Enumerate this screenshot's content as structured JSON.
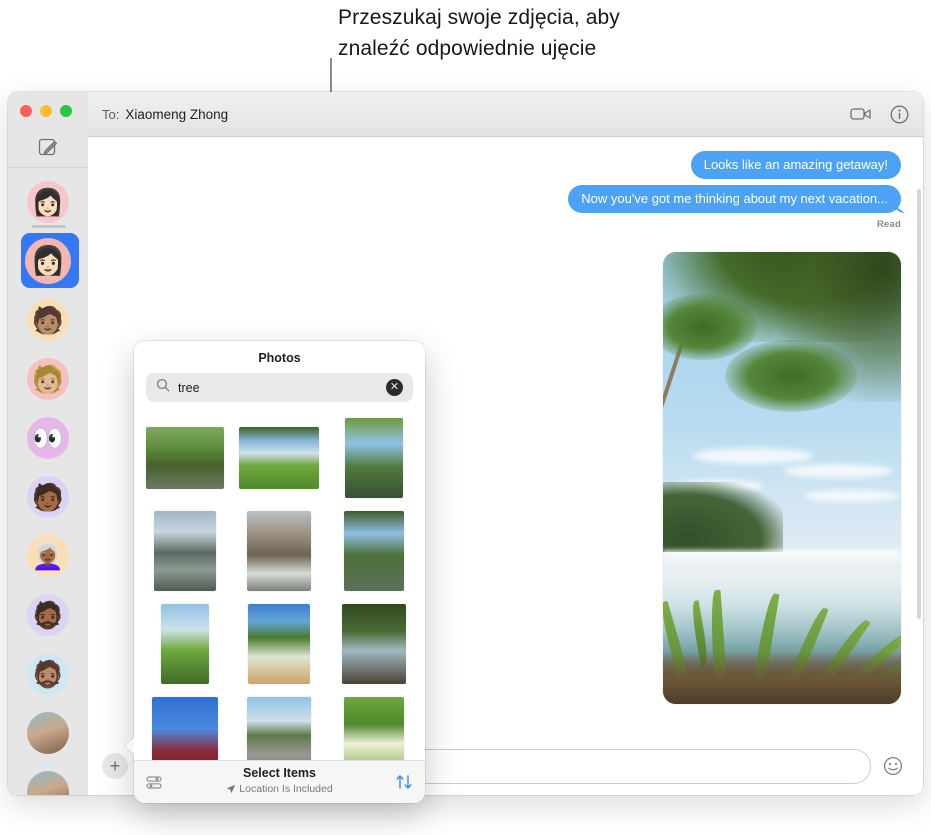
{
  "callout": {
    "line1": "Przeszukaj swoje zdjęcia, aby",
    "line2": "znaleźć odpowiednie ujęcie"
  },
  "colors": {
    "bubble_blue": "#4da2f5",
    "selection_blue": "#3478f6",
    "accent_blue": "#3d87f0",
    "sidebar_gray": "#e6e6e6",
    "titlebar_gray": "#e9e9e9"
  },
  "window": {
    "traffic_lights": [
      "close",
      "minimize",
      "zoom"
    ],
    "compose_icon": "compose-icon",
    "titlebar": {
      "to_label": "To:",
      "recipient": "Xiaomeng Zhong",
      "facetime_icon": "video-camera-icon",
      "info_icon": "info-circle-icon"
    }
  },
  "sidebar": {
    "conversations": [
      {
        "avatar": "memoji-woman-glasses",
        "emoji": "👩🏻",
        "bg": "#f7c6cc",
        "selected": false
      },
      {
        "avatar": "memoji-woman-bob",
        "emoji": "👩🏻",
        "bg": "#f3b7b0",
        "selected": true
      },
      {
        "avatar": "memoji-person-green-cap",
        "emoji": "🧑🏽",
        "bg": "#f7e0b5",
        "selected": false
      },
      {
        "avatar": "memoji-person-glasses",
        "emoji": "🧑🏼",
        "bg": "#f5c0c0",
        "selected": false
      },
      {
        "avatar": "memoji-eyes",
        "emoji": "👀",
        "bg": "#e7b6ea",
        "selected": false
      },
      {
        "avatar": "memoji-person-sunglasses",
        "emoji": "🧑🏾",
        "bg": "#ddd2f3",
        "selected": false
      },
      {
        "avatar": "memoji-woman-gray-hair",
        "emoji": "👩🏾‍🦳",
        "bg": "#fbdfb4",
        "selected": false
      },
      {
        "avatar": "memoji-man-beanie",
        "emoji": "🧔🏾",
        "bg": "#dcd4f5",
        "selected": false
      },
      {
        "avatar": "memoji-man-beard",
        "emoji": "🧔🏽",
        "bg": "#cfe7f5",
        "selected": false
      },
      {
        "avatar": "photo-avatar-woman",
        "emoji": "",
        "bg": "#cbbfae",
        "selected": false
      },
      {
        "avatar": "photo-avatar-person",
        "emoji": "",
        "bg": "#e8a65a",
        "selected": false
      }
    ]
  },
  "conversation": {
    "messages": [
      {
        "text": "Looks like an amazing getaway!",
        "side": "outgoing",
        "tail": false
      },
      {
        "text": "Now you've got me thinking about my next vacation...",
        "side": "outgoing",
        "tail": true
      }
    ],
    "read_receipt": "Read",
    "attachment": {
      "name": "tropical-beach-palm-trees-photo",
      "description": "Palm trees over a tropical beach with green foliage"
    }
  },
  "composer": {
    "add_button_label": "+",
    "add_button_icon": "plus-icon",
    "input_value": "",
    "input_placeholder": "",
    "emoji_icon": "smiley-face-icon"
  },
  "photos_popover": {
    "title": "Photos",
    "search": {
      "icon": "magnifying-glass-icon",
      "value": "tree",
      "placeholder": "Search",
      "clear_icon": "clear-circle-icon",
      "clear_glyph": "✕"
    },
    "grid": [
      {
        "name": "forest-rocks-photo",
        "w": 78,
        "h": 62,
        "scene": "forest"
      },
      {
        "name": "meadow-trees-photo",
        "w": 80,
        "h": 62,
        "scene": "meadow"
      },
      {
        "name": "palm-tree-river-photo",
        "w": 58,
        "h": 80,
        "scene": "palm-river"
      },
      {
        "name": "sea-cliffs-photo",
        "w": 62,
        "h": 80,
        "scene": "cliffs"
      },
      {
        "name": "coastal-rocks-photo",
        "w": 64,
        "h": 80,
        "scene": "cliffs2"
      },
      {
        "name": "jungle-river-photo",
        "w": 60,
        "h": 80,
        "scene": "jungle-river"
      },
      {
        "name": "palm-grass-photo",
        "w": 48,
        "h": 80,
        "scene": "palm-grass"
      },
      {
        "name": "dog-in-flowers-photo",
        "w": 62,
        "h": 80,
        "scene": "dog"
      },
      {
        "name": "palm-path-photo",
        "w": 64,
        "h": 80,
        "scene": "palm-path"
      },
      {
        "name": "red-leaves-sky-photo",
        "w": 66,
        "h": 80,
        "scene": "red-leaves"
      },
      {
        "name": "beach-shore-photo",
        "w": 64,
        "h": 80,
        "scene": "beach"
      },
      {
        "name": "white-flower-photo",
        "w": 60,
        "h": 80,
        "scene": "flower"
      }
    ],
    "footer": {
      "options_icon": "sliders-icon",
      "title": "Select Items",
      "location_icon": "location-arrow-icon",
      "subtitle": "Location Is Included",
      "sort_icon": "up-down-arrows-icon"
    }
  }
}
